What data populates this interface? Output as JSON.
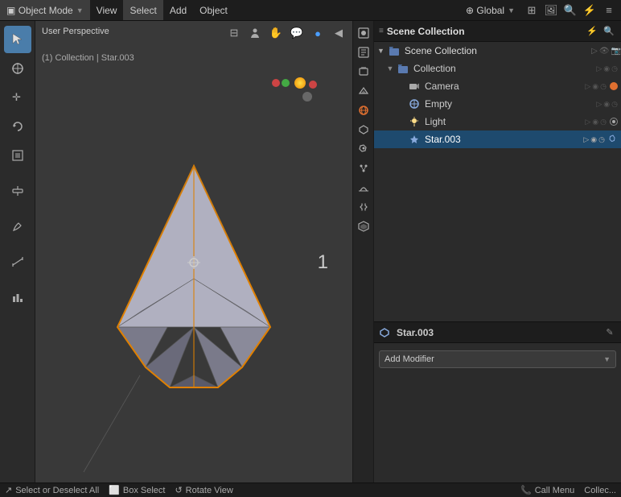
{
  "topbar": {
    "mode_icon": "▣",
    "mode_label": "Object Mode",
    "view_label": "View",
    "select_label": "Select",
    "add_label": "Add",
    "object_label": "Object",
    "global_label": "Global",
    "header_icons": [
      "⊞",
      "🖼",
      "🔍",
      "⚡",
      "⊟"
    ]
  },
  "viewport": {
    "perspective_label": "User Perspective",
    "collection_label": "(1) Collection | Star.003",
    "icons": [
      "⊟",
      "👤",
      "✋",
      "💬",
      "🔵"
    ],
    "object_number": "1"
  },
  "outliner": {
    "title": "Scene Collection",
    "scene_collection_label": "Scene Collection",
    "items": [
      {
        "id": "collection",
        "label": "Collection",
        "indent": 0,
        "expanded": true,
        "icon": "📁",
        "icon_color": "collection"
      },
      {
        "id": "camera",
        "label": "Camera",
        "indent": 1,
        "expanded": false,
        "icon": "📷",
        "icon_color": "camera"
      },
      {
        "id": "empty",
        "label": "Empty",
        "indent": 1,
        "expanded": false,
        "icon": "⬡",
        "icon_color": "object"
      },
      {
        "id": "light",
        "label": "Light",
        "indent": 1,
        "expanded": false,
        "icon": "💡",
        "icon_color": "light"
      },
      {
        "id": "star003",
        "label": "Star.003",
        "indent": 1,
        "expanded": false,
        "icon": "⬟",
        "icon_color": "object",
        "selected": true
      }
    ]
  },
  "properties": {
    "object_name": "Star.003",
    "add_modifier_label": "Add Modifier",
    "edit_icon": "✎"
  },
  "right_sidebar": {
    "icons": [
      "🎬",
      "📷",
      "🖼",
      "🔧",
      "⬟",
      "🔗",
      "🌐",
      "⬡",
      "🔩",
      "🎯",
      "⚙"
    ]
  },
  "bottom_bar": {
    "items": [
      {
        "icon": "↗",
        "label": "Select or Deselect All"
      },
      {
        "icon": "⬜",
        "label": "Box Select"
      },
      {
        "icon": "↺",
        "label": "Rotate View"
      },
      {
        "icon": "📞",
        "label": "Call Menu"
      },
      {
        "label": "Collec..."
      }
    ]
  }
}
